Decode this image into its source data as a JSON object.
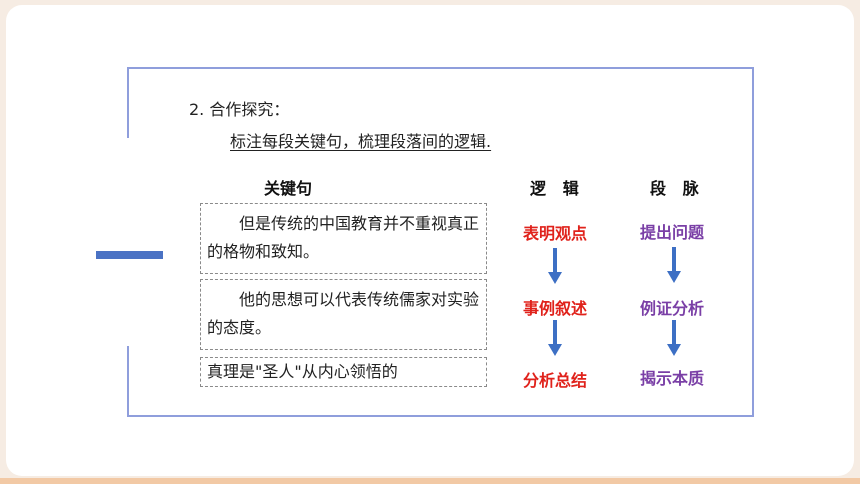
{
  "heading": "2. 合作探究：",
  "instruction": "标注每段关键句，梳理段落间的逻辑.",
  "columns": {
    "key_sentence": "关键句",
    "logic": "逻   辑",
    "paragraph_flow": "段   脉"
  },
  "sentences": [
    "但是传统的中国教育并不重视真正的格物和致知。",
    "他的思想可以代表传统儒家对实验的态度。",
    "真理是\"圣人\"从内心领悟的"
  ],
  "logic_steps": [
    "表明观点",
    "事例叙述",
    "分析总结"
  ],
  "flow_steps": [
    "提出问题",
    "例证分析",
    "揭示本质"
  ],
  "colors": {
    "logic_text": "#e0221b",
    "flow_text": "#7a3fa6",
    "arrow": "#3d6fc4",
    "frame": "#8f9edc",
    "accent_bar": "#4a72c4"
  }
}
